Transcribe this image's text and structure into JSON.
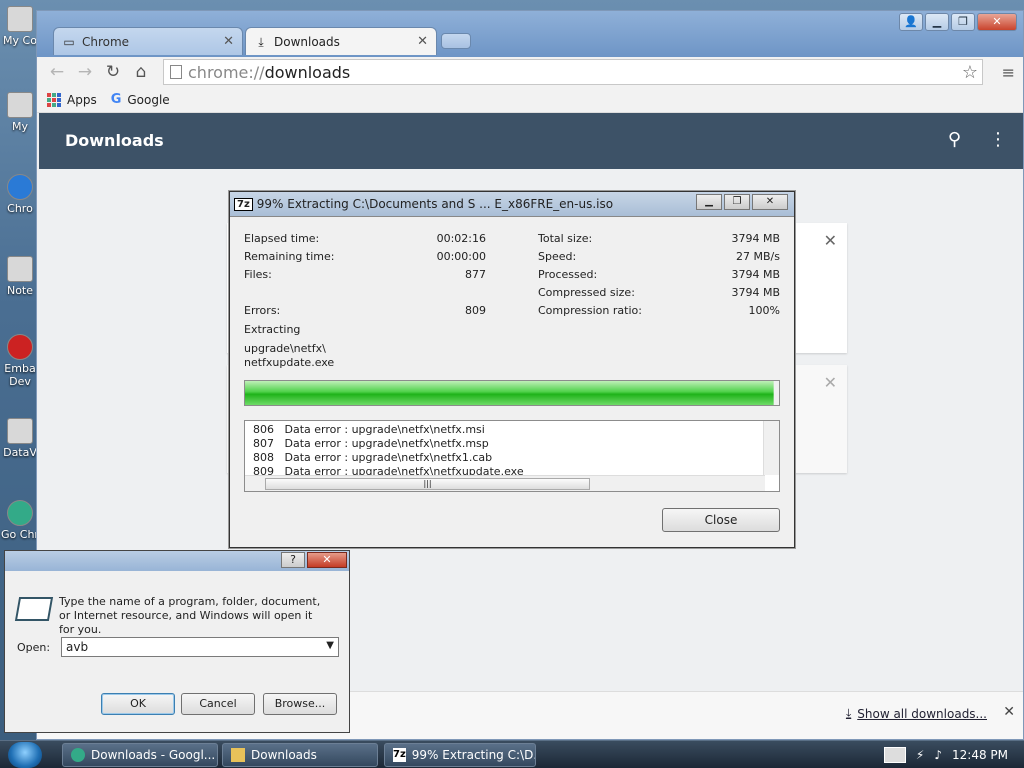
{
  "desktop": {
    "icons": [
      "My Co",
      "My",
      "Chro",
      "Note",
      "Emba Dev",
      "DataV",
      "Go Chr"
    ]
  },
  "chrome": {
    "tabs": [
      {
        "label": "Chrome",
        "icon": "page-icon"
      },
      {
        "label": "Downloads",
        "icon": "download-icon"
      }
    ],
    "omnibox": {
      "scheme": "chrome://",
      "host": "downloads"
    },
    "bookmarks": [
      "Apps",
      "Google"
    ],
    "page_title": "Downloads",
    "show_all": "Show all downloads..."
  },
  "zip": {
    "title": "99% Extracting C:\\Documents and S ... E_x86FRE_en-us.iso",
    "logo": "7z",
    "left_labels": [
      "Elapsed time:",
      "Remaining time:",
      "Files:",
      "",
      "Errors:"
    ],
    "left_values": [
      "00:02:16",
      "00:00:00",
      "877",
      "",
      "809"
    ],
    "right_labels": [
      "Total size:",
      "Speed:",
      "Processed:",
      "Compressed size:",
      "Compression ratio:"
    ],
    "right_values": [
      "3794 MB",
      "27 MB/s",
      "3794 MB",
      "3794 MB",
      "100%"
    ],
    "status": "Extracting",
    "current_path": "upgrade\\netfx\\",
    "current_file": "netfxupdate.exe",
    "progress": 0.99,
    "log": [
      {
        "num": "806",
        "text": "Data error : upgrade\\netfx\\netfx.msi"
      },
      {
        "num": "807",
        "text": "Data error : upgrade\\netfx\\netfx.msp"
      },
      {
        "num": "808",
        "text": "Data error : upgrade\\netfx\\netfx1.cab"
      },
      {
        "num": "809",
        "text": "Data error : upgrade\\netfx\\netfxupdate.exe"
      }
    ],
    "close_label": "Close"
  },
  "run": {
    "description": "Type the name of a program, folder, document, or Internet resource, and Windows will open it for you.",
    "open_label": "Open:",
    "open_value": "avb",
    "ok_label": "OK",
    "cancel_label": "Cancel",
    "browse_label": "Browse..."
  },
  "taskbar": {
    "tasks": [
      "Downloads - Googl...",
      "Downloads",
      "99% Extracting C:\\D..."
    ],
    "time": "12:48 PM"
  }
}
